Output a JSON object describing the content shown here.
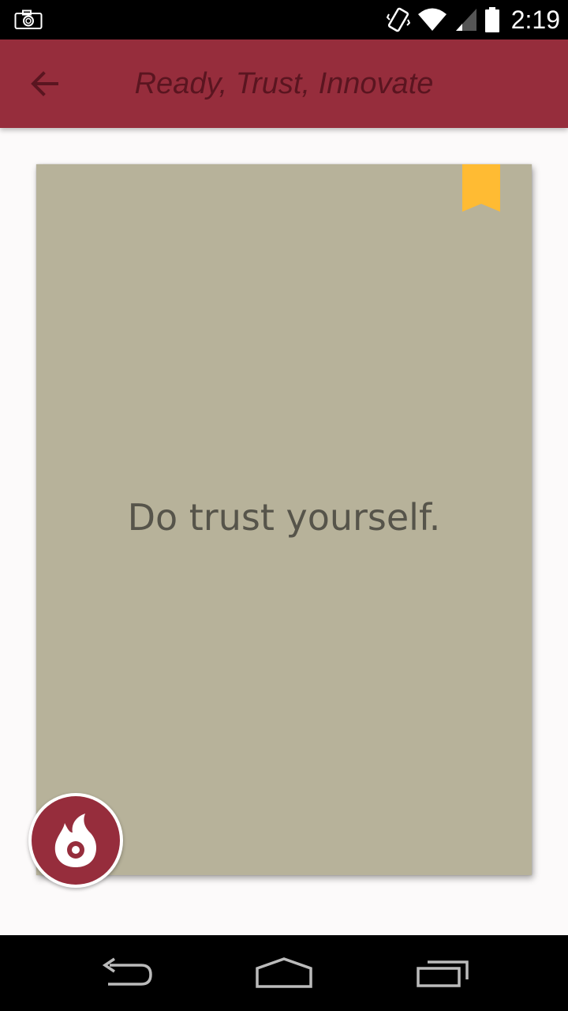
{
  "status_bar": {
    "time": "2:19",
    "icons": [
      "camera-icon",
      "vibrate-icon",
      "wifi-icon",
      "signal-icon",
      "battery-icon"
    ]
  },
  "app_bar": {
    "title": "Ready, Trust, Innovate",
    "back_icon": "arrow-back-icon",
    "background_color": "#962d3c"
  },
  "card": {
    "text": "Do trust yourself.",
    "background_color": "#b7b29a",
    "bookmark_color": "#ffbb33"
  },
  "fab": {
    "icon": "flame-icon",
    "color": "#962d3c"
  },
  "nav_bar": {
    "buttons": [
      "back-icon",
      "home-icon",
      "recents-icon"
    ]
  }
}
